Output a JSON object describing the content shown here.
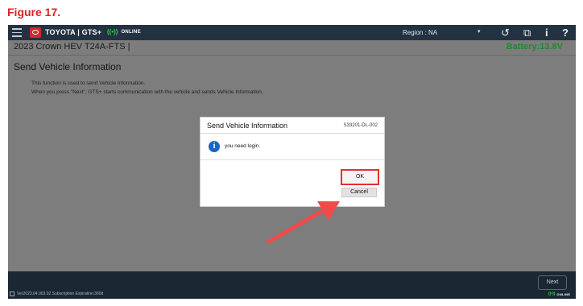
{
  "figure_caption": "Figure 17.",
  "header": {
    "brand": "TOYOTA | GTS+",
    "connection_status": "ONLINE",
    "region": "Region : NA",
    "icons": [
      "menu-icon",
      "toyota-logo-icon",
      "wifi-icon",
      "history-icon",
      "external-link-icon",
      "info-icon",
      "help-icon"
    ]
  },
  "vehicle": {
    "name": "2023 Crown HEV T24A-FTS  |",
    "battery": "Battery:13.8V"
  },
  "page": {
    "title": "Send Vehicle Information",
    "description_lines": [
      "This function is used to send Vehicle Information.",
      "When you press \"Next\", GTS+ starts communication with the vehicle and sends Vehicle Information."
    ]
  },
  "dialog": {
    "title": "Send Vehicle Information",
    "code": "S33201-DL-002",
    "message": "you need login.",
    "ok_label": "OK",
    "cancel_label": "Cancel"
  },
  "footer": {
    "next_label": "Next",
    "status": "Ver2023.04.003.02  Subscription Expiration:360d",
    "connection_status": "ONLINE"
  },
  "colors": {
    "caption_red": "#e02020",
    "highlight_red": "#e53030",
    "battery_green": "#1f8a2d",
    "online_green": "#33d04a"
  }
}
